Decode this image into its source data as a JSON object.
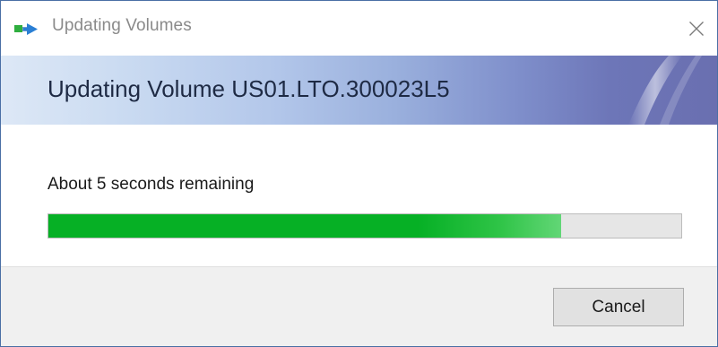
{
  "window": {
    "title": "Updating Volumes",
    "icon": "volume-update-icon",
    "close_icon": "close-icon"
  },
  "banner": {
    "heading": "Updating Volume US01.LTO.300023L5"
  },
  "status": {
    "text": "About 5 seconds remaining"
  },
  "progress": {
    "fraction": 0.81,
    "fill_color": "#06b025",
    "track_color": "#e6e6e6"
  },
  "footer": {
    "cancel_label": "Cancel"
  },
  "colors": {
    "window_border": "#4a6fa5",
    "banner_gradient_start": "#dde8f6",
    "banner_gradient_end": "#6a6fb0",
    "footer_bg": "#f0f0f0"
  }
}
